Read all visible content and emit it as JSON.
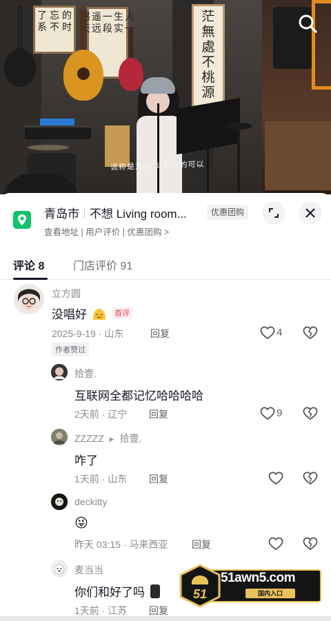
{
  "video": {
    "subtitle": "谎称是友谊 却疏远的可以",
    "calligraphy": {
      "left": "的时 忘不 了系",
      "middle": "人一 生实 一段 遥远 感天",
      "right": "茫 無 處 不 桃 源"
    }
  },
  "poi": {
    "city": "青岛市",
    "name": "不想 Living room...",
    "badge": "优惠团购",
    "links": "查看地址 | 用户评价 | 优惠团购 >"
  },
  "tabs": [
    {
      "label": "评论 8"
    },
    {
      "label": "门店评价 91"
    }
  ],
  "comments": [
    {
      "user": "立方圆",
      "text": "没唱好",
      "badge": "首评",
      "meta": "2025-9-19 · 山东",
      "reply": "回复",
      "likes": "4",
      "author_liked": "作者赞过",
      "replies": [
        {
          "user": "拾壹.",
          "text": "互联网全都记忆哈哈哈哈",
          "meta": "2天前 · 辽宁",
          "reply": "回复",
          "likes": "9"
        },
        {
          "user": "ZZZZZ",
          "reply_to": "拾壹.",
          "text": "咋了",
          "meta": "1天前 · 山东",
          "reply": "回复",
          "likes": ""
        },
        {
          "user": "deckitty",
          "text": "😜",
          "meta": "昨天 03:15 · 马来西亚",
          "reply": "回复",
          "likes": ""
        },
        {
          "user": "麦当当",
          "text": "你们和好了吗",
          "meta": "1天前 · 江苏",
          "reply": "回复",
          "likes": ""
        }
      ]
    }
  ],
  "ad": {
    "url": "51awn5.com",
    "button": "国内入口",
    "logo_text": "51"
  },
  "colors": {
    "accent_red": "#e43f5c",
    "text_primary": "#161823",
    "text_secondary": "#8a8b91",
    "pin_green": "#13c26a",
    "ad_gold": "#e7c15a"
  }
}
